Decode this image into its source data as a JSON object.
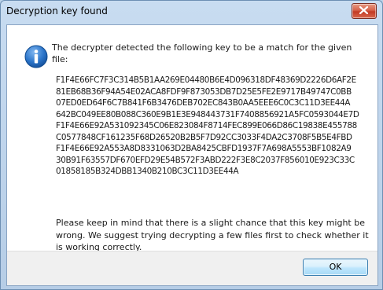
{
  "window": {
    "title": "Decryption key found",
    "close_icon": "close-icon"
  },
  "icon": "info-icon",
  "message": {
    "intro": "The decrypter detected the following key to be a match for the given file:",
    "key_lines": [
      "F1F4E66FC7F3C314B5B1AA269E04480B6E4D096318DF48369D2226D6AF2E",
      "81EB68B36F94A54E02ACA8FDF9F873053DB7D25E5FE2E9717B49747C0BB",
      "07ED0ED64F6C7B841F6B3476DEB702EC843B0AA5EEE6C0C3C11D3EE44A",
      "642BC049EE80B088C360E9B1E3E948443731F7408856921A5FC0593044E7D",
      "F1F4E66E92A531092345C06E823084F8714FEC899E066D86C19838E455788",
      "C0577848CF161235F68D26520B2B5F7D92CC3033F4DA2C3708F5B5E4FBD",
      "F1F4E66E92A553A8D8331063D2BA8425CBFD1937F7A698A5553BF1082A9",
      "30B91F63557DF670EFD29E54B572F3ABD222F3E8C2037F856010E923C33C",
      "01858185B324DBB1340B210BC3C11D3EE44A"
    ],
    "note": "Please keep in mind that there is a slight chance that this key might be wrong. We suggest trying decrypting a few files first to check whether it is working correctly."
  },
  "footer": {
    "ok_label": "OK"
  },
  "colors": {
    "frame": "#bcd3ea",
    "close_button": "#c33a23",
    "ok_button": "#bee6fd",
    "info_icon": "#1a63b8"
  }
}
